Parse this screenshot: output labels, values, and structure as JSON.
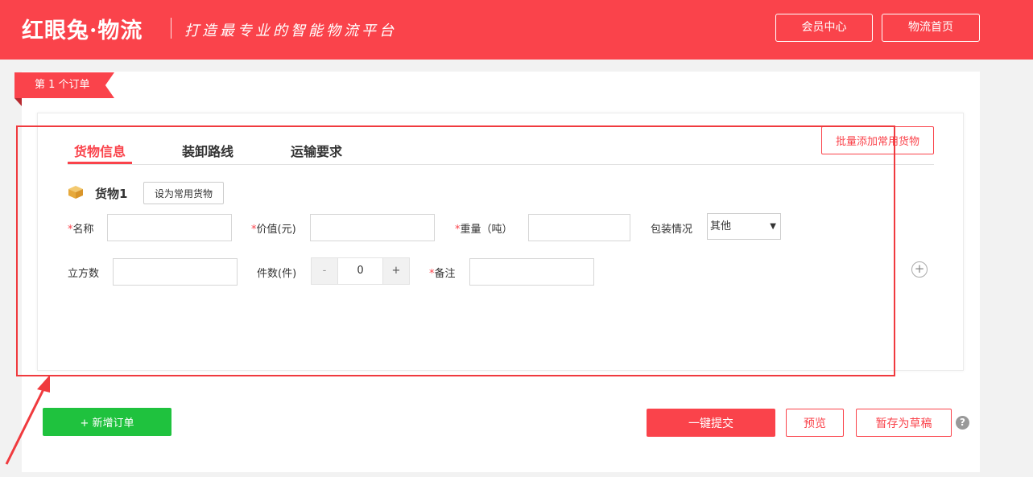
{
  "header": {
    "logo_text": "红眼兔·物流",
    "slogan": "打造最专业的智能物流平台",
    "member_center_label": "会员中心",
    "logistics_home_label": "物流首页"
  },
  "order": {
    "tag_label": "第 1 个订单",
    "tabs": [
      {
        "label": "货物信息",
        "active": true
      },
      {
        "label": "装卸路线",
        "active": false
      },
      {
        "label": "运输要求",
        "active": false
      }
    ],
    "batch_add_label": "批量添加常用货物",
    "goods": {
      "title": "货物1",
      "set_common_label": "设为常用货物",
      "fields": {
        "name_label": "名称",
        "value_label": "价值(元)",
        "weight_label": "重量（吨）",
        "package_label": "包装情况",
        "package_selected": "其他",
        "volume_label": "立方数",
        "pieces_label": "件数(件)",
        "pieces_value": "0",
        "minus_label": "-",
        "plus_label": "+",
        "remark_label": "备注",
        "required_mark": "*"
      }
    },
    "add_goods_symbol": "+"
  },
  "footer": {
    "add_order_label": "+ 新增订单",
    "submit_label": "一键提交",
    "preview_label": "预览",
    "save_draft_label": "暂存为草稿",
    "help_symbol": "?"
  },
  "colors": {
    "brand_red": "#fa434b",
    "green": "#1fc23e",
    "annotation_red": "#f03a3e"
  },
  "icons": {
    "goods_icon": "package-box-icon",
    "add_icon": "plus-circle-icon",
    "help_icon": "question-circle-icon"
  }
}
